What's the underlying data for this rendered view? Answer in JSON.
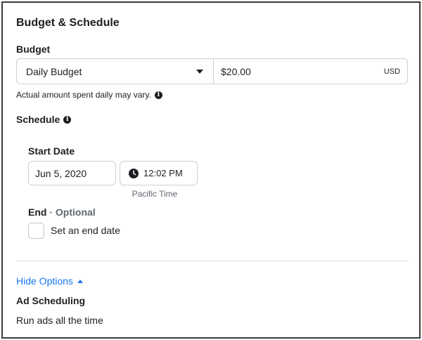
{
  "section": {
    "title": "Budget & Schedule"
  },
  "budget": {
    "label": "Budget",
    "type_selected": "Daily Budget",
    "amount": "$20.00",
    "currency": "USD",
    "hint": "Actual amount spent daily may vary."
  },
  "schedule": {
    "label": "Schedule",
    "start_label": "Start Date",
    "start_date": "Jun 5, 2020",
    "start_time": "12:02 PM",
    "timezone": "Pacific Time",
    "end_label": "End",
    "end_optional": "· Optional",
    "end_checkbox_label": "Set an end date",
    "end_checked": false
  },
  "options": {
    "toggle_label": "Hide Options",
    "ad_scheduling_label": "Ad Scheduling",
    "ad_scheduling_value": "Run ads all the time"
  },
  "icons": {
    "info": "info-icon",
    "clock": "clock-icon",
    "dropdown": "chevron-down-icon",
    "collapse": "chevron-up-icon"
  },
  "colors": {
    "link": "#1877f2",
    "border": "#ccd0d5",
    "muted": "#606770"
  }
}
